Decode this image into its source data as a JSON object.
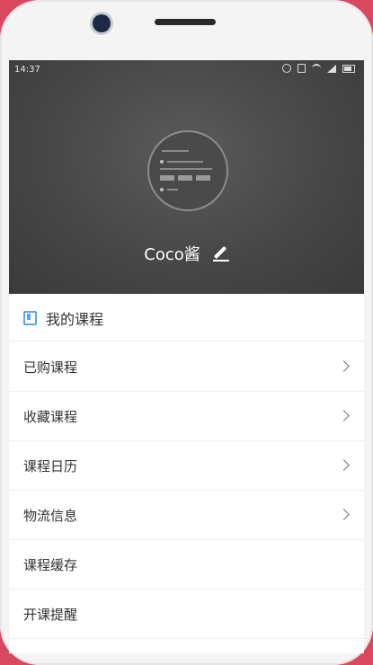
{
  "status_bar": {
    "time": "14:37"
  },
  "profile": {
    "username": "Coco酱"
  },
  "section": {
    "title": "我的课程"
  },
  "menu": [
    {
      "label": "已购课程",
      "has_arrow": true
    },
    {
      "label": "收藏课程",
      "has_arrow": true
    },
    {
      "label": "课程日历",
      "has_arrow": true
    },
    {
      "label": "物流信息",
      "has_arrow": true
    },
    {
      "label": "课程缓存",
      "has_arrow": false
    },
    {
      "label": "开课提醒",
      "has_arrow": false
    }
  ],
  "colors": {
    "accent": "#5aa6e6",
    "header_bg": "#474747",
    "frame": "#d9485f"
  }
}
